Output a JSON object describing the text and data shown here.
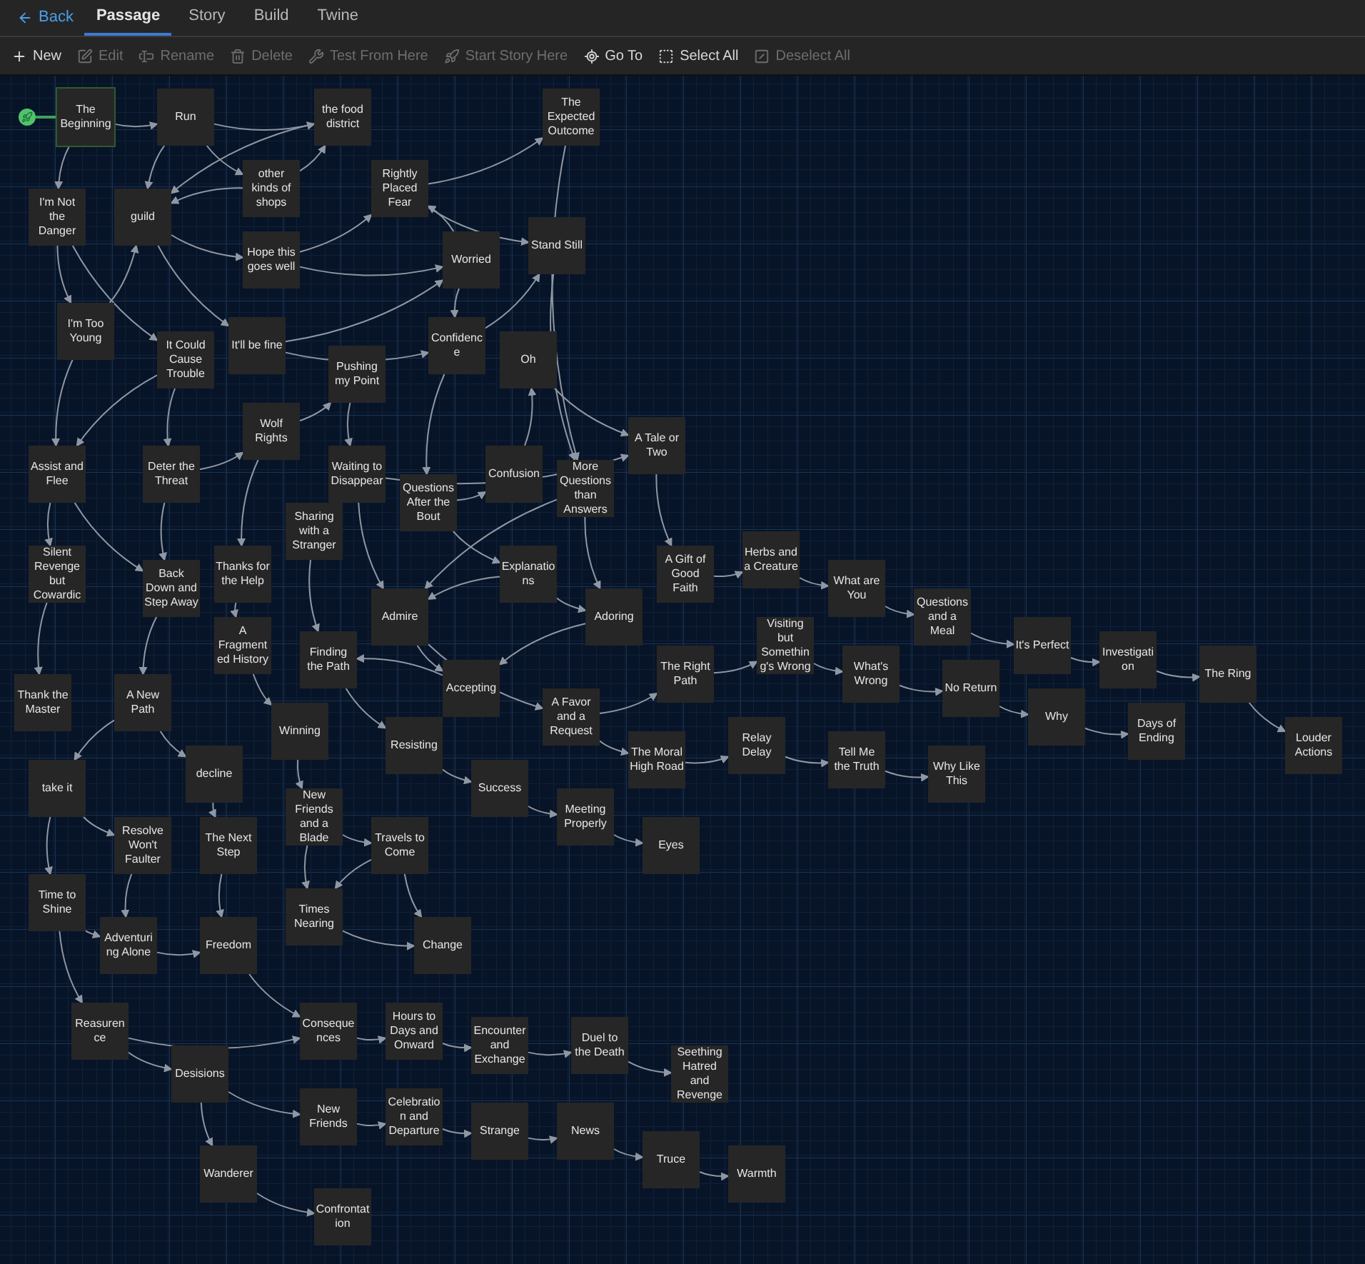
{
  "top_bar": {
    "back": {
      "label": "Back"
    },
    "tabs": [
      {
        "label": "Passage",
        "selected": true
      },
      {
        "label": "Story",
        "selected": false
      },
      {
        "label": "Build",
        "selected": false
      },
      {
        "label": "Twine",
        "selected": false
      }
    ]
  },
  "toolbar": [
    {
      "label": "New",
      "disabled": false
    },
    {
      "label": "Edit",
      "disabled": true
    },
    {
      "label": "Rename",
      "disabled": true
    },
    {
      "label": "Delete",
      "disabled": true
    },
    {
      "label": "Test From Here",
      "disabled": true
    },
    {
      "label": "Start Story Here",
      "disabled": true
    },
    {
      "label": "Go To",
      "disabled": false
    },
    {
      "label": "Select All",
      "disabled": false
    },
    {
      "label": "Deselect All",
      "disabled": true
    }
  ],
  "passages": [
    {
      "name": "The Beginning",
      "start": true
    },
    {
      "name": "Run",
      "start": false
    },
    {
      "name": "the food district",
      "start": false
    },
    {
      "name": "The Expected Outcome",
      "start": false
    },
    {
      "name": "I'm Not the Danger",
      "start": false
    },
    {
      "name": "guild",
      "start": false
    },
    {
      "name": "other kinds of shops",
      "start": false
    },
    {
      "name": "Rightly Placed Fear",
      "start": false
    },
    {
      "name": "Hope this goes well",
      "start": false
    },
    {
      "name": "Worried",
      "start": false
    },
    {
      "name": "Stand Still",
      "start": false
    },
    {
      "name": "I'm Too Young",
      "start": false
    },
    {
      "name": "It Could Cause Trouble",
      "start": false
    },
    {
      "name": "It'll be fine",
      "start": false
    },
    {
      "name": "Confidence",
      "start": false
    },
    {
      "name": "Oh",
      "start": false
    },
    {
      "name": "Pushing my Point",
      "start": false
    },
    {
      "name": "Wolf Rights",
      "start": false
    },
    {
      "name": "A Tale or Two",
      "start": false
    },
    {
      "name": "Assist and Flee",
      "start": false
    },
    {
      "name": "Deter the Threat",
      "start": false
    },
    {
      "name": "Waiting to Disappear",
      "start": false
    },
    {
      "name": "Confusion",
      "start": false
    },
    {
      "name": "Questions After the Bout",
      "start": false
    },
    {
      "name": "More Questions than Answers",
      "start": false
    },
    {
      "name": "Sharing with a Stranger",
      "start": false
    },
    {
      "name": "Silent Revenge but Cowardic",
      "start": false
    },
    {
      "name": "Thanks for the Help",
      "start": false
    },
    {
      "name": "Back Down and Step Away",
      "start": false
    },
    {
      "name": "Explanations",
      "start": false
    },
    {
      "name": "A Gift of Good Faith",
      "start": false
    },
    {
      "name": "Herbs and a Creature",
      "start": false
    },
    {
      "name": "What are You",
      "start": false
    },
    {
      "name": "Admire",
      "start": false
    },
    {
      "name": "Adoring",
      "start": false
    },
    {
      "name": "A Fragmented History",
      "start": false
    },
    {
      "name": "Finding the Path",
      "start": false
    },
    {
      "name": "Questions and a Meal",
      "start": false
    },
    {
      "name": "Visiting but Something's Wrong",
      "start": false
    },
    {
      "name": "It's Perfect",
      "start": false
    },
    {
      "name": "Thank the Master",
      "start": false
    },
    {
      "name": "A New Path",
      "start": false
    },
    {
      "name": "Accepting",
      "start": false
    },
    {
      "name": "The Right Path",
      "start": false
    },
    {
      "name": "What's Wrong",
      "start": false
    },
    {
      "name": "Investigation",
      "start": false
    },
    {
      "name": "The Ring",
      "start": false
    },
    {
      "name": "No Return",
      "start": false
    },
    {
      "name": "Winning",
      "start": false
    },
    {
      "name": "A Favor and a Request",
      "start": false
    },
    {
      "name": "Why",
      "start": false
    },
    {
      "name": "Resisting",
      "start": false
    },
    {
      "name": "The Moral High Road",
      "start": false
    },
    {
      "name": "Relay Delay",
      "start": false
    },
    {
      "name": "Days of Ending",
      "start": false
    },
    {
      "name": "Louder Actions",
      "start": false
    },
    {
      "name": "Tell Me the Truth",
      "start": false
    },
    {
      "name": "Why Like This",
      "start": false
    },
    {
      "name": "take it",
      "start": false
    },
    {
      "name": "decline",
      "start": false
    },
    {
      "name": "Success",
      "start": false
    },
    {
      "name": "New Friends and a Blade",
      "start": false
    },
    {
      "name": "Meeting Properly",
      "start": false
    },
    {
      "name": "Resolve Won't Faulter",
      "start": false
    },
    {
      "name": "The Next Step",
      "start": false
    },
    {
      "name": "Travels to Come",
      "start": false
    },
    {
      "name": "Eyes",
      "start": false
    },
    {
      "name": "Time to Shine",
      "start": false
    },
    {
      "name": "Times Nearing",
      "start": false
    },
    {
      "name": "Adventuring Alone",
      "start": false
    },
    {
      "name": "Freedom",
      "start": false
    },
    {
      "name": "Change",
      "start": false
    },
    {
      "name": "Reasurence",
      "start": false
    },
    {
      "name": "Consequences",
      "start": false
    },
    {
      "name": "Hours to Days and Onward",
      "start": false
    },
    {
      "name": "Encounter and Exchange",
      "start": false
    },
    {
      "name": "Duel to the Death",
      "start": false
    },
    {
      "name": "Desisions",
      "start": false
    },
    {
      "name": "Seething Hatred and Revenge",
      "start": false
    },
    {
      "name": "New Friends",
      "start": false
    },
    {
      "name": "Celebration and Departure",
      "start": false
    },
    {
      "name": "Strange",
      "start": false
    },
    {
      "name": "News",
      "start": false
    },
    {
      "name": "Truce",
      "start": false
    },
    {
      "name": "Warmth",
      "start": false
    },
    {
      "name": "Wanderer",
      "start": false
    },
    {
      "name": "Confrontation",
      "start": false
    }
  ]
}
